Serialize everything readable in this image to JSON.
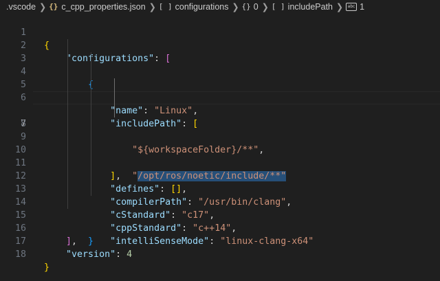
{
  "breadcrumb": {
    "folder": ".vscode",
    "file": "c_cpp_properties.json",
    "configurations": "configurations",
    "index": "0",
    "includePath": "includePath",
    "item_index": "1",
    "file_icon": "braces-icon",
    "array_icon": "brackets-icon",
    "object_icon": "braces-icon",
    "string_icon": "string-icon"
  },
  "editor": {
    "active_line": 7,
    "line_numbers": [
      "1",
      "2",
      "3",
      "4",
      "5",
      "6",
      "7",
      "8",
      "9",
      "10",
      "11",
      "12",
      "13",
      "14",
      "15",
      "16",
      "17",
      "18"
    ],
    "code": {
      "open_brace": "{",
      "configurations_key": "\"configurations\"",
      "open_bracket": "[",
      "obj_open": "{",
      "name_key": "\"name\"",
      "name_value": "\"Linux\"",
      "include_key": "\"includePath\"",
      "include_open": "[",
      "include_item_1": "\"${workspaceFolder}/**\"",
      "include_item_2": "\"/opt/ros/noetic/include/**\"",
      "include_close": "]",
      "defines_key": "\"defines\"",
      "defines_value": "[]",
      "compiler_key": "\"compilerPath\"",
      "compiler_value": "\"/usr/bin/clang\"",
      "cstd_key": "\"cStandard\"",
      "cstd_value": "\"c17\"",
      "cppstd_key": "\"cppStandard\"",
      "cppstd_value": "\"c++14\"",
      "intelli_key": "\"intelliSenseMode\"",
      "intelli_value": "\"linux-clang-x64\"",
      "obj_close": "}",
      "close_bracket": "]",
      "version_key": "\"version\"",
      "version_value": "4",
      "close_brace": "}"
    }
  },
  "colors": {
    "background": "#1f1f1f",
    "key": "#9cdcfe",
    "string": "#ce9178",
    "number": "#b5cea8",
    "bracket_level1": "#ffd700",
    "bracket_level2": "#da70d6",
    "bracket_level3": "#179fff",
    "selection": "#264f78"
  }
}
